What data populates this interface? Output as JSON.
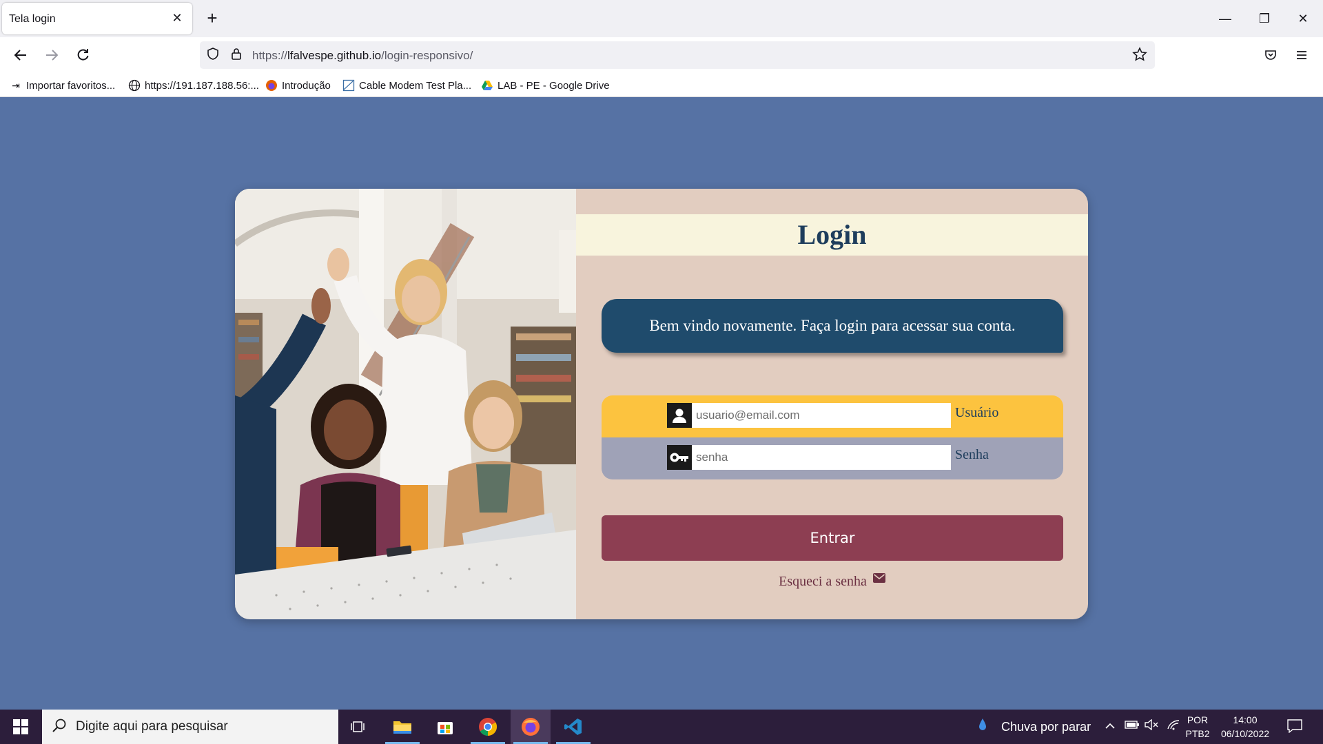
{
  "browser": {
    "tab_title": "Tela login",
    "tab_close": "✕",
    "new_tab": "+",
    "window_controls": {
      "minimize": "—",
      "restore": "❐",
      "close": "✕"
    },
    "url_prefix": "https://",
    "url_host": "lfalvespe.github.io",
    "url_path": "/login-responsivo/",
    "bookmarks": [
      {
        "icon": "import-icon",
        "label": "Importar favoritos..."
      },
      {
        "icon": "globe-icon",
        "label": "https://191.187.188.56:..."
      },
      {
        "icon": "firefox-icon",
        "label": "Introdução"
      },
      {
        "icon": "page-icon",
        "label": "Cable Modem Test Pla..."
      },
      {
        "icon": "google-drive-icon",
        "label": "LAB - PE - Google Drive"
      }
    ]
  },
  "login": {
    "title": "Login",
    "welcome": "Bem vindo novamente. Faça login para acessar sua conta.",
    "user_placeholder": "usuario@email.com",
    "user_label": "Usuário",
    "password_placeholder": "senha",
    "password_label": "Senha",
    "submit_label": "Entrar",
    "forgot_label": "Esqueci a senha",
    "colors": {
      "background": "#5672a4",
      "card": "#e2cdc0",
      "title_bar": "#f8f4dd",
      "title_text": "#1e3d5c",
      "welcome_box": "#1f4b6c",
      "user_row": "#fcc33f",
      "password_row": "#9fa2b7",
      "submit_button": "#8d3e52"
    }
  },
  "taskbar": {
    "search_placeholder": "Digite aqui para pesquisar",
    "weather": "Chuva por parar",
    "lang_top": "POR",
    "lang_bottom": "PTB2",
    "time": "14:00",
    "date": "06/10/2022"
  }
}
